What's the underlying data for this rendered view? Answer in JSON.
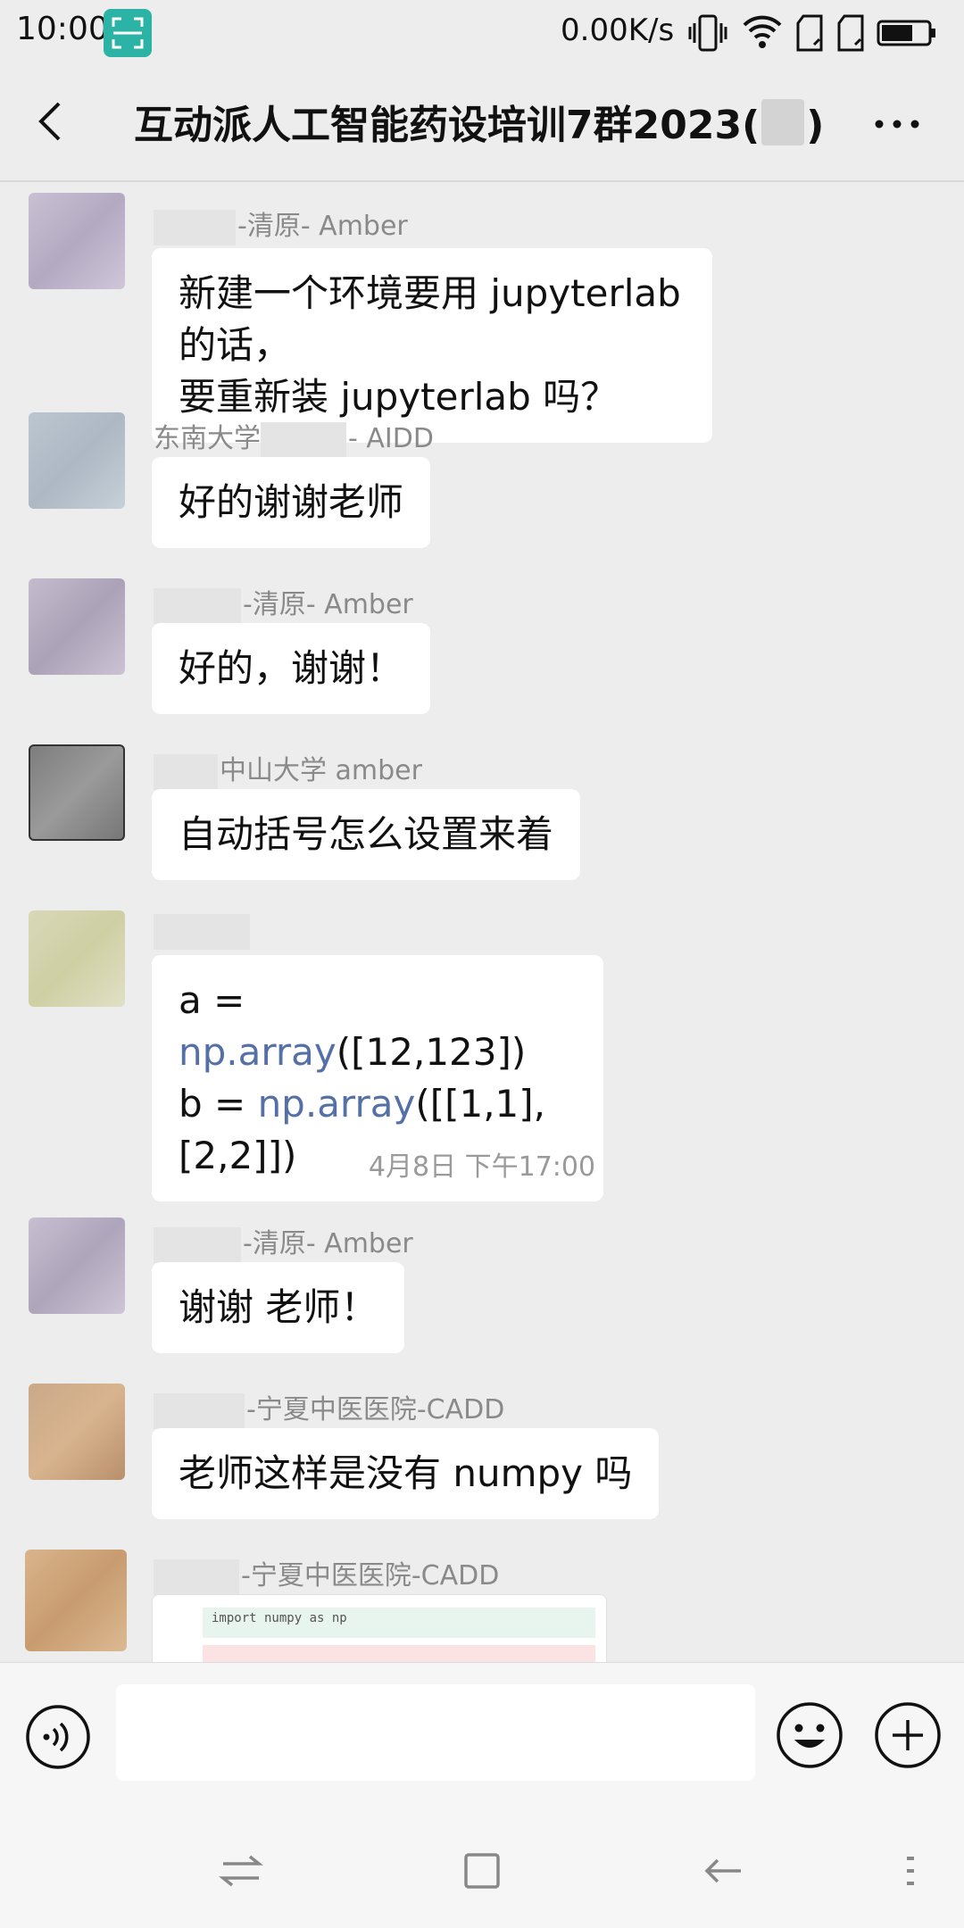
{
  "status_bar": {
    "time": "10:00",
    "net_speed": "0.00K/s",
    "icons": [
      "scan-icon",
      "vibrate-icon",
      "wifi-icon",
      "sim-no-service-icon",
      "sim-no-service-icon",
      "battery-icon"
    ]
  },
  "header": {
    "title_prefix": "互动派人工智能药设培训7群2023(",
    "title_suffix": ")",
    "back_icon": "chevron-left-icon",
    "more_icon": "more-dots-icon"
  },
  "messages": [
    {
      "sender": "-清原- Amber",
      "text_lines": [
        "新建一个环境要用 jupyterlab 的话，",
        "要重新装 jupyterlab 吗？"
      ]
    },
    {
      "sender_prefix": "东南大学",
      "sender": "- AIDD",
      "text_lines": [
        "好的谢谢老师"
      ]
    },
    {
      "sender": "-清原- Amber",
      "text_lines": [
        "好的，谢谢！"
      ]
    },
    {
      "sender": "中山大学 amber",
      "text_lines": [
        "自动括号怎么设置来着"
      ]
    },
    {
      "sender": "",
      "code_lines": [
        {
          "pre": "a = ",
          "fn": "np.array",
          "post": "([12,123])"
        },
        {
          "pre": "b = ",
          "fn": "np.array",
          "post": "([[1,1],[2,2]])"
        }
      ]
    },
    {
      "timestamp": "4月8日 下午17:00"
    },
    {
      "sender": "-清原- Amber",
      "text_lines": [
        "谢谢 老师！"
      ]
    },
    {
      "sender": "-宁夏中医医院-CADD",
      "text_lines": [
        "老师这样是没有 numpy 吗"
      ]
    },
    {
      "sender": "-宁夏中医医院-CADD",
      "image_caption": "import numpy as np"
    }
  ],
  "input_bar": {
    "voice_icon": "voice-icon",
    "emoji_icon": "emoji-icon",
    "plus_icon": "plus-icon",
    "input_value": ""
  },
  "system_nav": [
    "switch-icon",
    "home-square-icon",
    "back-arrow-icon",
    "menu-dots-icon"
  ],
  "colors": {
    "background": "#ededed",
    "bubble": "#ffffff",
    "code_fn": "#5470a6",
    "scan_badge": "#2bb3a6"
  }
}
